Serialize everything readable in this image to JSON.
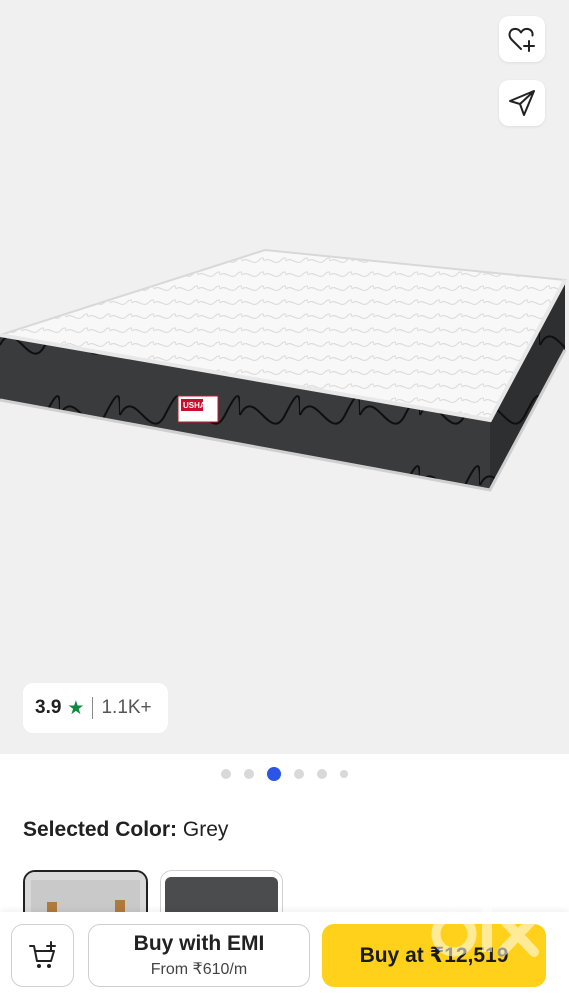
{
  "product": {
    "brand_logo_text": "USHA",
    "rating": {
      "score": "3.9",
      "star_icon": "star-icon",
      "count": "1.1K+"
    },
    "carousel": {
      "total": 6,
      "active_index": 2
    }
  },
  "actions": {
    "wishlist_icon": "heart-plus-icon",
    "share_icon": "send-icon"
  },
  "color_selector": {
    "label": "Selected Color:",
    "value": "Grey",
    "options": [
      "Grey",
      "Grey"
    ]
  },
  "bottom_bar": {
    "cart_icon": "cart-plus-icon",
    "emi_title": "Buy with EMI",
    "emi_subtitle": "From ₹610/m",
    "buy_label": "Buy at ₹12,519"
  },
  "watermark": "olx",
  "colors": {
    "buy_button": "#ffd11a",
    "active_dot": "#2a55e5",
    "rating_star": "#0c8a3d"
  }
}
